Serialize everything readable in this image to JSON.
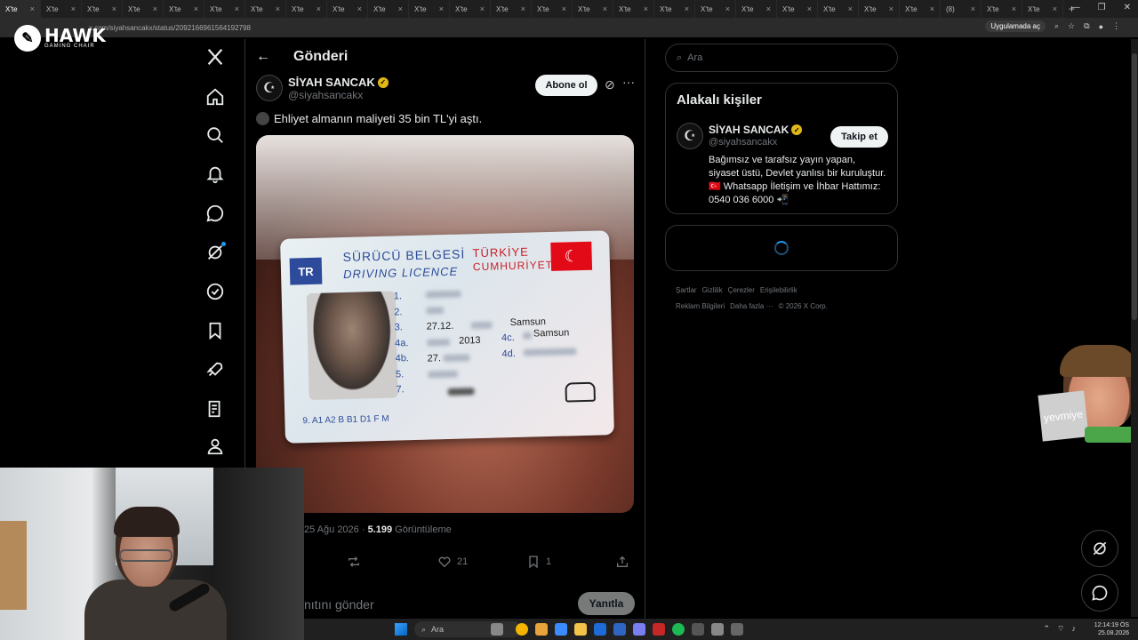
{
  "browser": {
    "tabs": [
      "X'te",
      "X'te",
      "X'te",
      "X'te",
      "X'te",
      "X'te",
      "X'te",
      "X'te",
      "X'te",
      "X'te",
      "X'te",
      "X'te",
      "X'te",
      "X'te",
      "X'te",
      "X'te",
      "X'te",
      "X'te",
      "X'te",
      "X'te",
      "X'te",
      "X'te",
      "X'te",
      "(8)",
      "X'te",
      "X'te"
    ],
    "url": "x.com/siyahsancakx/status/2092166961564192798",
    "app_chip": "Uygulamada aç"
  },
  "overlay": {
    "brand_name": "HAWK",
    "brand_sub": "GAMING CHAIR",
    "sticker_text": "yevmiye"
  },
  "header": {
    "title": "Gönderi"
  },
  "post": {
    "author_name": "SİYAH SANCAK",
    "author_handle": "@siyahsancakx",
    "subscribe_label": "Abone ol",
    "text": "Ehliyet almanın maliyeti 35 bin TL'yi aştı.",
    "date": "25 Ağu 2026",
    "views_count": "5.199",
    "views_label": "Görüntüleme",
    "likes": "21",
    "bookmarks": "1",
    "reply_placeholder": "nıtını gönder",
    "reply_button": "Yanıtla"
  },
  "license": {
    "country_code": "TR",
    "title_tr": "SÜRÜCÜ BELGESİ",
    "title_en": "DRIVING LICENCE",
    "country_line1": "TÜRKİYE",
    "country_line2": "CUMHURİYETİ",
    "field_numbers": [
      "1.",
      "2.",
      "3.",
      "4a.",
      "4b.",
      "5.",
      "7."
    ],
    "dob_partial": "27.12.",
    "birthplace": "Samsun",
    "label_4c": "4c.",
    "issuer": "Samsun",
    "issue_year": "2013",
    "expiry_partial": "27.",
    "label_4d": "4d.",
    "categories": "9.  A1 A2 B B1 D1 F M"
  },
  "sidebar_right": {
    "search_placeholder": "Ara",
    "related_title": "Alakalı kişiler",
    "related_name": "SİYAH SANCAK",
    "related_handle": "@siyahsancakx",
    "follow_label": "Takip et",
    "bio": "Bağımsız ve tarafsız yayın yapan, siyaset üstü, Devlet yanlısı bir kuruluştur. 🇹🇷 Whatsapp İletişim ve İhbar Hattımız: 0540 036 6000 📲",
    "footer_links": [
      "Şartlar",
      "Gizlilik",
      "Çerezler",
      "Erişilebilirlik",
      "Reklam Bilgileri",
      "Daha fazla ···",
      "© 2026 X Corp."
    ]
  },
  "taskbar": {
    "search_label": "Ara",
    "time": "12:14:19 ÖS",
    "date": "25.08.2026"
  },
  "colors": {
    "accent": "#1d9bf0",
    "verified": "#e2b719",
    "background": "#000000"
  }
}
